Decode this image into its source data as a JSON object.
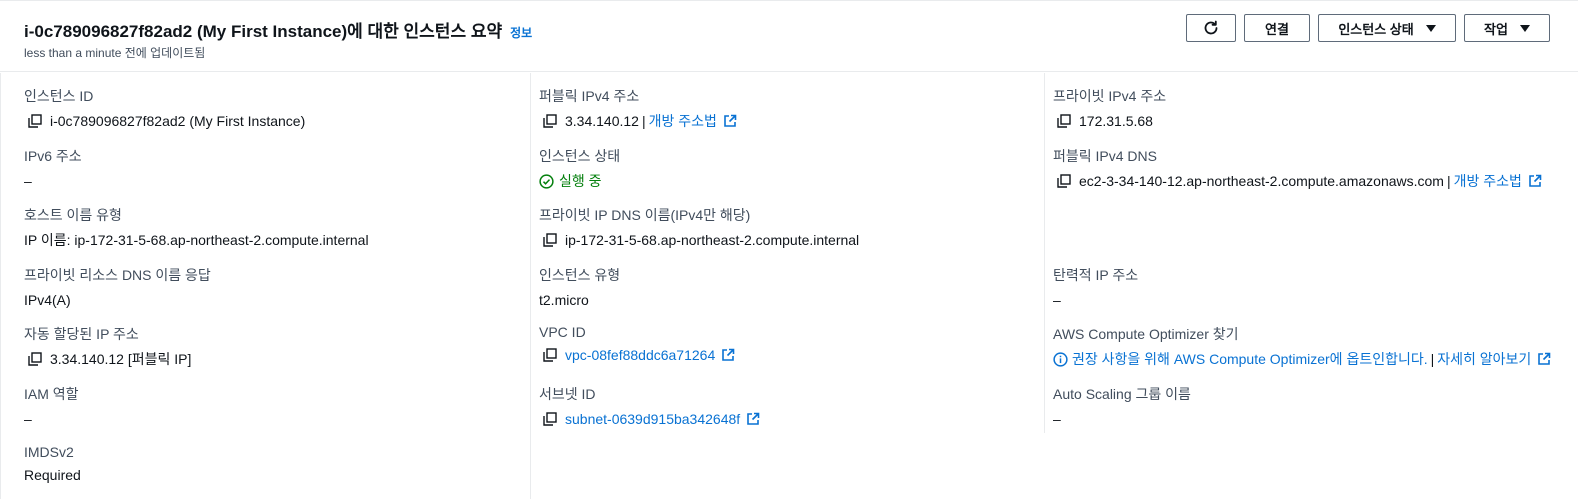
{
  "header": {
    "title": "i-0c789096827f82ad2 (My First Instance)에 대한 인스턴스 요약",
    "info_label": "정보",
    "subtitle": "less than a minute 전에 업데이트됨",
    "buttons": {
      "refresh": "refresh-icon",
      "connect": "연결",
      "instance_state": "인스턴스 상태",
      "actions": "작업"
    }
  },
  "col1": {
    "instance_id": {
      "label": "인스턴스 ID",
      "value": "i-0c789096827f82ad2 (My First Instance)"
    },
    "ipv6": {
      "label": "IPv6 주소",
      "value": "–"
    },
    "hostname_type": {
      "label": "호스트 이름 유형",
      "value": "IP 이름: ip-172-31-5-68.ap-northeast-2.compute.internal"
    },
    "private_dns_answer": {
      "label": "프라이빗 리소스 DNS 이름 응답",
      "value": "IPv4(A)"
    },
    "auto_ip": {
      "label": "자동 할당된 IP 주소",
      "value": "3.34.140.12 [퍼블릭 IP]"
    },
    "iam_role": {
      "label": "IAM 역할",
      "value": "–"
    },
    "imdsv2": {
      "label": "IMDSv2",
      "value": "Required"
    }
  },
  "col2": {
    "public_ipv4": {
      "label": "퍼블릭 IPv4 주소",
      "value": "3.34.140.12",
      "link": "개방 주소법"
    },
    "instance_state": {
      "label": "인스턴스 상태",
      "value": "실행 중"
    },
    "private_ip_dns": {
      "label": "프라이빗 IP DNS 이름(IPv4만 해당)",
      "value": "ip-172-31-5-68.ap-northeast-2.compute.internal"
    },
    "instance_type": {
      "label": "인스턴스 유형",
      "value": "t2.micro"
    },
    "vpc_id": {
      "label": "VPC ID",
      "value": "vpc-08fef88ddc6a71264"
    },
    "subnet_id": {
      "label": "서브넷 ID",
      "value": "subnet-0639d915ba342648f"
    }
  },
  "col3": {
    "private_ipv4": {
      "label": "프라이빗 IPv4 주소",
      "value": "172.31.5.68"
    },
    "public_dns": {
      "label": "퍼블릭 IPv4 DNS",
      "value": "ec2-3-34-140-12.ap-northeast-2.compute.amazonaws.com",
      "link": "개방 주소법"
    },
    "elastic_ip": {
      "label": "탄력적 IP 주소",
      "value": "–"
    },
    "optimizer": {
      "label": "AWS Compute Optimizer 찾기",
      "value": "권장 사항을 위해 AWS Compute Optimizer에 옵트인합니다.",
      "link": "자세히 알아보기"
    },
    "asg_name": {
      "label": "Auto Scaling 그룹 이름",
      "value": "–"
    }
  },
  "colors": {
    "link": "#0972d3",
    "success": "#037f0c",
    "label": "#414d5c",
    "text": "#0f141a",
    "border": "#e9ebed"
  }
}
